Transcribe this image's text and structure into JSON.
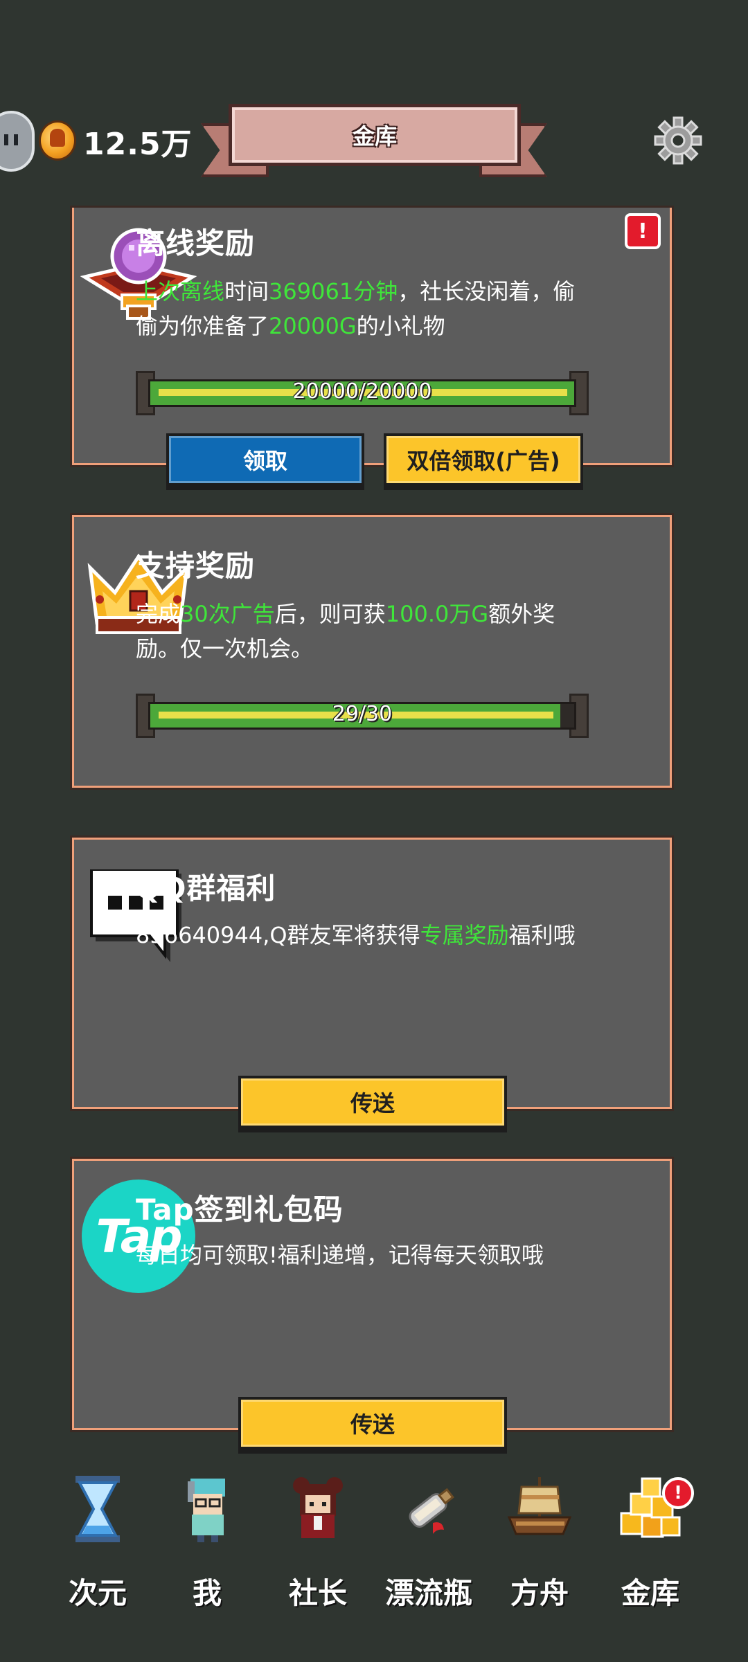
{
  "header": {
    "coins": "12.5万",
    "title": "金库"
  },
  "offline": {
    "title": "离线奖励",
    "desc_p1": "上次离线",
    "desc_p2": "时间",
    "desc_p3": "369061分钟",
    "desc_p4": "，社长没闲着，偷偷为你准备了",
    "desc_p5": "20000G",
    "desc_p6": "的小礼物",
    "progress_text": "20000/20000",
    "progress": 1.0,
    "claim": "领取",
    "double_claim": "双倍领取(广告)",
    "alert": "!"
  },
  "support": {
    "title": "支持奖励",
    "desc_p1": "完成",
    "desc_p2": "30次广告",
    "desc_p3": "后，则可获",
    "desc_p4": "100.0万G",
    "desc_p5": "额外奖励。仅一次机会。",
    "progress_text": "29/30",
    "progress": 0.9667
  },
  "qq": {
    "title": "QQ群福利",
    "desc_p1": "856640944,Q群友军将获得",
    "desc_p2": "专属奖励",
    "desc_p3": "福利哦",
    "button": "传送"
  },
  "tap": {
    "title": "Tap签到礼包码",
    "logo_text": "Tap",
    "desc": "每日均可领取!福利递增，记得每天领取哦",
    "button": "传送"
  },
  "nav": {
    "items": [
      "次元",
      "我",
      "社长",
      "漂流瓶",
      "方舟",
      "金库"
    ],
    "alert": "!"
  },
  "colors": {
    "background": "#2f3530",
    "card": "#5c5c5c",
    "card_border": "#f0a07a",
    "highlight_green": "#3fe63a",
    "button_blue": "#0f6ab4",
    "button_yellow": "#fcc52a",
    "alert_red": "#e31b2c"
  },
  "icons": [
    "coin-icon",
    "gear-icon",
    "crystal-ball-icon",
    "crown-icon",
    "chat-bubble-icon",
    "tap-logo-icon",
    "hourglass-icon",
    "player-icon",
    "president-icon",
    "drift-bottle-icon",
    "ark-ship-icon",
    "gold-vault-icon"
  ]
}
